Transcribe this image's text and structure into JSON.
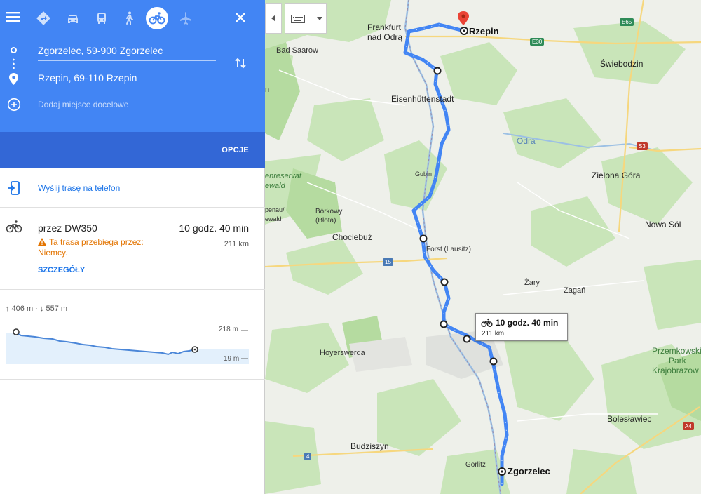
{
  "colors": {
    "header": "#4285f4",
    "header_band": "#3367d6",
    "route": "#4285f4",
    "link": "#1a73e8",
    "warning": "#e37400"
  },
  "modes": [
    {
      "name": "best-route-icon",
      "active": false
    },
    {
      "name": "car-icon",
      "active": false
    },
    {
      "name": "transit-icon",
      "active": false
    },
    {
      "name": "walk-icon",
      "active": false
    },
    {
      "name": "bicycle-icon",
      "active": true
    },
    {
      "name": "flight-icon",
      "active": false
    }
  ],
  "directions": {
    "origin": "Zgorzelec, 59-900 Zgorzelec",
    "destination": "Rzepin, 69-110 Rzepin",
    "add_destination": "Dodaj miejsce docelowe",
    "options_label": "OPCJE"
  },
  "send": {
    "label": "Wyślij trasę na telefon"
  },
  "route": {
    "via": "przez DW350",
    "time": "10 godz. 40 min",
    "distance": "211 km",
    "warning": "Ta trasa przebiega przez: Niemcy.",
    "details_label": "SZCZEGÓŁY"
  },
  "elevation": {
    "stats": "↑ 406 m · ↓ 557 m",
    "max_label": "218 m",
    "min_label": "19 m"
  },
  "map": {
    "places": {
      "frankfurt_1": "Frankfurt",
      "frankfurt_2": "nad Odrą",
      "rzepin": "Rzepin",
      "bad_saarow": "Bad Saarow",
      "swiebodzin": "Świebodzin",
      "eisenhuttenstadt": "Eisenhüttenstadt",
      "odra": "Odra",
      "guben": "Gubin",
      "zielona_gora": "Zielona Góra",
      "reservat_1": "enreservat",
      "reservat_2": "ewald",
      "borkowy_1": "Bórkowy",
      "borkowy_2": "(Błota)",
      "spreewald_1": "penau/",
      "spreewald_2": "ewald",
      "chociebuz": "Chociebuż",
      "forst": "Forst (Lausitz)",
      "nowa_sol": "Nowa Sól",
      "zary": "Żary",
      "zagan": "Żagań",
      "hoyerswerda": "Hoyerswerda",
      "przemkowski_1": "Przemkowski",
      "przemkowski_2": "Park",
      "przemkowski_3": "Krajobrazow",
      "boleslawiec": "Bolesławiec",
      "budziszyn": "Budziszyn",
      "gorlitz": "Görlitz",
      "zgorzelec": "Zgorzelec",
      "partial_n": "n"
    },
    "shields": {
      "e65": "E65",
      "e30": "E30",
      "s3": "S3",
      "r15": "15",
      "a4": "A4",
      "r4": "4"
    },
    "route_box": {
      "time": "10 godz. 40 min",
      "distance": "211 km"
    }
  }
}
